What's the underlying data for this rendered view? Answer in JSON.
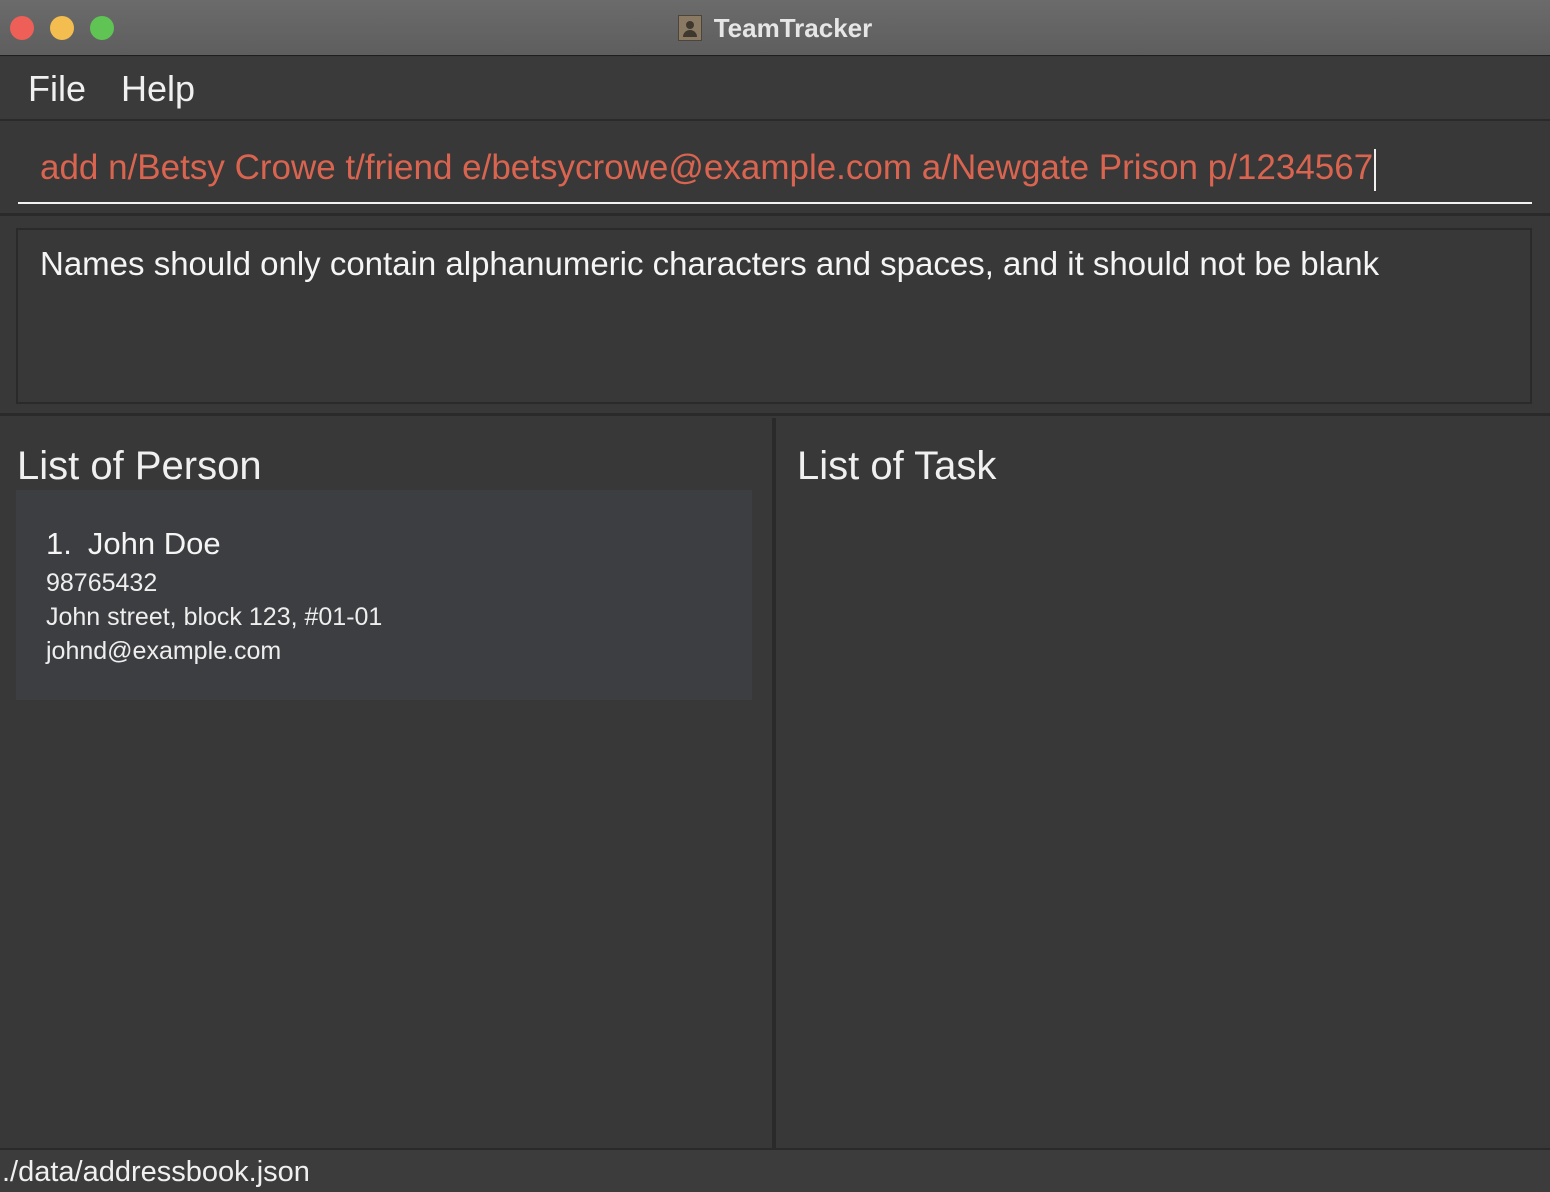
{
  "window": {
    "title": "TeamTracker"
  },
  "menu": {
    "items": [
      {
        "label": "File"
      },
      {
        "label": "Help"
      }
    ]
  },
  "command": {
    "value": "add n/Betsy Crowe t/friend e/betsycrowe@example.com a/Newgate Prison p/1234567",
    "text_color": "#d9644f"
  },
  "result": {
    "message": "Names should only contain alphanumeric characters and spaces, and it should not be blank"
  },
  "person_list": {
    "heading": "List of Person",
    "persons": [
      {
        "index": "1.",
        "name": "John Doe",
        "phone": "98765432",
        "address": "John street, block 123, #01-01",
        "email": "johnd@example.com"
      }
    ]
  },
  "task_list": {
    "heading": "List of Task"
  },
  "status": {
    "path": "./data/addressbook.json"
  },
  "colors": {
    "close": "#ee5f57",
    "minimize": "#f4bd4f",
    "zoom": "#5fc454"
  },
  "icons": {
    "app": "contacts-app-icon"
  }
}
